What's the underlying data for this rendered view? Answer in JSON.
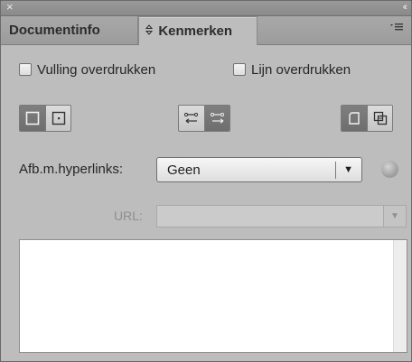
{
  "titlebar": {
    "close_glyph": "×",
    "collapse_glyph": "‹‹"
  },
  "tabs": [
    {
      "label": "Documentinfo",
      "active": false
    },
    {
      "label": "Kenmerken",
      "active": true,
      "prefix_icon": "up-down-arrows-icon"
    }
  ],
  "panel_menu_icon": "panel-menu-icon",
  "checkboxes": {
    "fill_overprint": {
      "label": "Vulling overdrukken",
      "checked": false
    },
    "stroke_overprint": {
      "label": "Lijn overdrukken",
      "checked": false
    }
  },
  "buttons": {
    "group1": [
      "nonprinting-icon",
      "center-box-icon"
    ],
    "group2": [
      "arrow-left-icon",
      "arrow-right-icon"
    ],
    "group3": [
      "page-icon",
      "stack-icon"
    ]
  },
  "hyperlinks": {
    "label": "Afb.m.hyperlinks:",
    "value": "Geen",
    "icon": "globe-icon"
  },
  "url": {
    "label": "URL:",
    "value": ""
  },
  "colors": {
    "panel_bg": "#bdbdbd",
    "tab_bar": "#a2a2a2",
    "dark_button": "#757575"
  }
}
